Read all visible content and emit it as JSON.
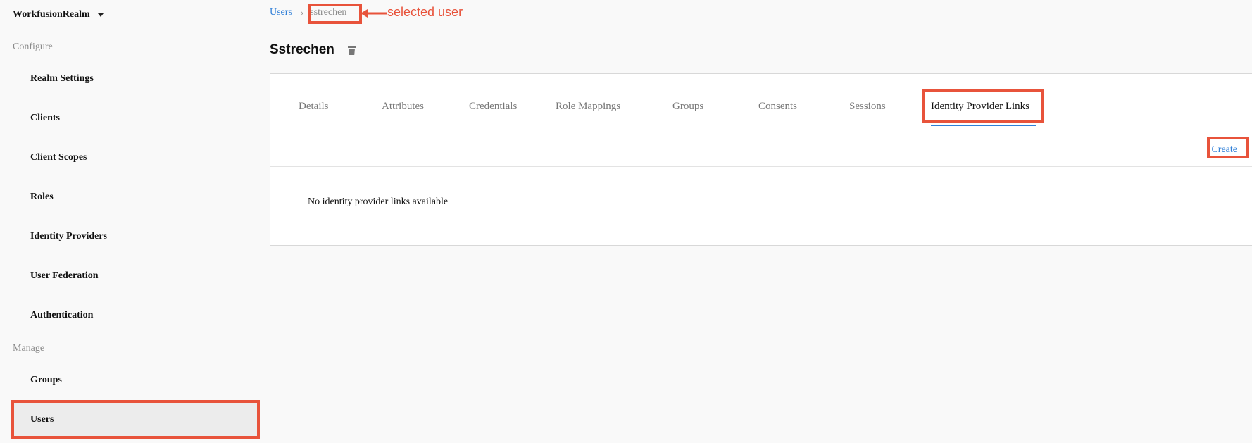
{
  "realm": {
    "name": "WorkfusionRealm"
  },
  "sidebar": {
    "configure_label": "Configure",
    "manage_label": "Manage",
    "configure_items": [
      {
        "label": "Realm Settings"
      },
      {
        "label": "Clients"
      },
      {
        "label": "Client Scopes"
      },
      {
        "label": "Roles"
      },
      {
        "label": "Identity Providers"
      },
      {
        "label": "User Federation"
      },
      {
        "label": "Authentication"
      }
    ],
    "manage_items": [
      {
        "label": "Groups"
      },
      {
        "label": "Users",
        "active": true
      }
    ]
  },
  "breadcrumb": {
    "parent": "Users",
    "current": "sstrechen"
  },
  "annotation": {
    "text": "selected user"
  },
  "page": {
    "title": "Sstrechen"
  },
  "tabs": [
    {
      "label": "Details"
    },
    {
      "label": "Attributes"
    },
    {
      "label": "Credentials"
    },
    {
      "label": "Role Mappings"
    },
    {
      "label": "Groups"
    },
    {
      "label": "Consents"
    },
    {
      "label": "Sessions"
    },
    {
      "label": "Identity Provider Links",
      "active": true
    }
  ],
  "toolbar": {
    "create_label": "Create"
  },
  "content": {
    "empty_message": "No identity provider links available"
  },
  "colors": {
    "accent": "#2f7fd8",
    "annotation": "#e8533b"
  },
  "icons": {
    "realm_dropdown": "caret-down-icon",
    "delete_user": "trash-icon"
  }
}
